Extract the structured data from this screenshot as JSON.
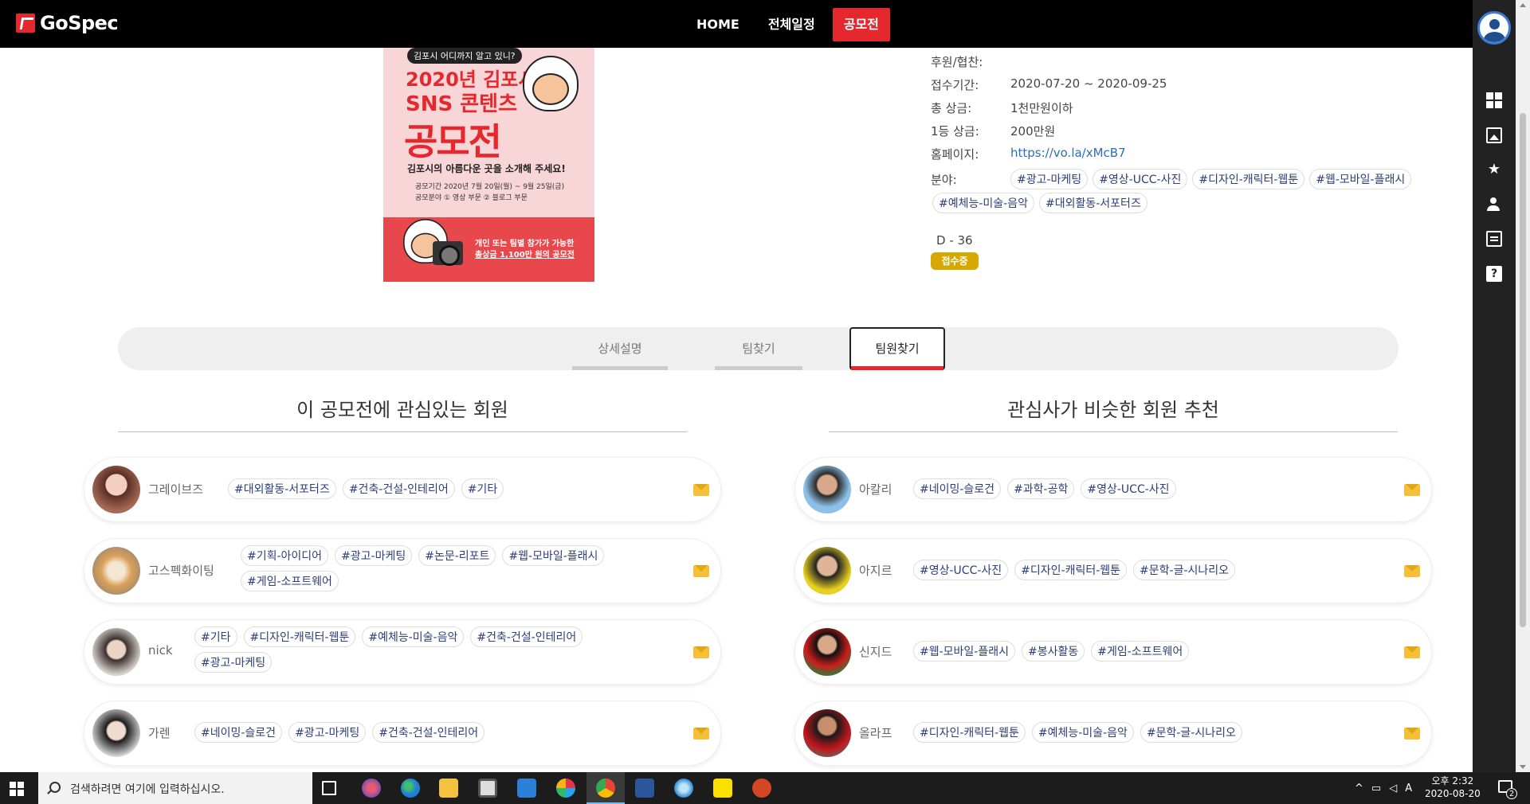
{
  "header": {
    "logo_text": "GoSpec",
    "nav": [
      "HOME",
      "전체일정",
      "공모전"
    ],
    "active_nav": "공모전"
  },
  "poster": {
    "top_badge": "김포시 어디까지 알고 있니?",
    "title_line1": "2020년 김포시",
    "title_line2": "SNS 콘텐츠",
    "title_line3": "공모전",
    "subtitle": "김포시의 아름다운 곳을 소개해 주세요!",
    "period_text": "공모기간 2020년 7월 20일(월) ~ 9월 25일(금)",
    "field_text": "공모분야 ① 영상 부문 ② 블로그 부문",
    "bottom_text_1": "개인 또는 팀별 참가가 가능한",
    "bottom_text_2": "총상금 1,100만 원의 공모전"
  },
  "info": {
    "sponsor_label": "후원/협찬:",
    "sponsor_value": "",
    "period_label": "접수기간:",
    "period_value": "2020-07-20 ~ 2020-09-25",
    "total_prize_label": "총 상금:",
    "total_prize_value": "1천만원이하",
    "first_prize_label": "1등 상금:",
    "first_prize_value": "200만원",
    "homepage_label": "홈페이지:",
    "homepage_value": "https://vo.la/xMcB7",
    "field_label": "분야:",
    "field_tags": [
      "#광고-마케팅",
      "#영상-UCC-사진",
      "#디자인-캐릭터-웹툰",
      "#웹-모바일-플래시",
      "#예체능-미술-음악",
      "#대외활동-서포터즈"
    ],
    "dday": "D - 36",
    "status": "접수중",
    "status_color": "#d6a800"
  },
  "tabs": [
    "상세설명",
    "팀찾기",
    "팀원찾기"
  ],
  "active_tab": "팀원찾기",
  "left_section": {
    "title": "이 공모전에 관심있는 회원",
    "members": [
      {
        "name": "그레이브즈",
        "tags": [
          "#대외활동-서포터즈",
          "#건축-건설-인테리어",
          "#기타"
        ]
      },
      {
        "name": "고스펙화이팅",
        "tags": [
          "#기획-아이디어",
          "#광고-마케팅",
          "#논문-리포트",
          "#웹-모바일-플래시",
          "#게임-소프트웨어"
        ]
      },
      {
        "name": "nick",
        "tags": [
          "#기타",
          "#디자인-캐릭터-웹툰",
          "#예체능-미술-음악",
          "#건축-건설-인테리어",
          "#광고-마케팅"
        ]
      },
      {
        "name": "가렌",
        "tags": [
          "#네이밍-슬로건",
          "#광고-마케팅",
          "#건축-건설-인테리어"
        ]
      }
    ]
  },
  "right_section": {
    "title": "관심사가 비슷한 회원 추천",
    "members": [
      {
        "name": "아칼리",
        "tags": [
          "#네이밍-슬로건",
          "#과학-공학",
          "#영상-UCC-사진"
        ]
      },
      {
        "name": "아지르",
        "tags": [
          "#영상-UCC-사진",
          "#디자인-캐릭터-웹툰",
          "#문학-글-시나리오"
        ]
      },
      {
        "name": "신지드",
        "tags": [
          "#웹-모바일-플래시",
          "#봉사활동",
          "#게임-소프트웨어"
        ]
      },
      {
        "name": "올라프",
        "tags": [
          "#디자인-캐릭터-웹툰",
          "#예체능-미술-음악",
          "#문학-글-시나리오"
        ]
      }
    ]
  },
  "taskbar": {
    "search_placeholder": "검색하려면 여기에 입력하십시오.",
    "time_period": "오후 2:32",
    "date": "2020-08-20",
    "ime": "A",
    "notification_count": "2"
  },
  "colors": {
    "brand_red": "#e5282d",
    "tag_text": "#2c3e7a",
    "mail_yellow": "#f5c038"
  }
}
